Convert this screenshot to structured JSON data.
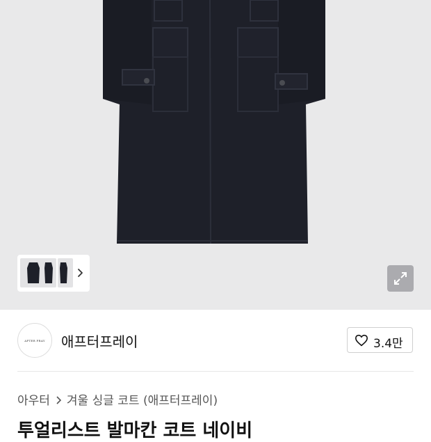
{
  "product": {
    "thumbnails": [
      {
        "name": "coat-front"
      },
      {
        "name": "coat-side"
      },
      {
        "name": "coat-back"
      }
    ],
    "icons": {
      "thumbs_next": "chevron-right-icon",
      "expand": "expand-icon",
      "like": "heart-icon",
      "breadcrumb_sep": "chevron-right-icon"
    },
    "brand": {
      "logo_text": "AFTER PRAY",
      "name": "애프터프레이"
    },
    "likes": {
      "count": "3.4만"
    },
    "breadcrumb": {
      "category": "아우터",
      "subcategory": "겨울 싱글 코트 (애프터프레이)"
    },
    "title": "투얼리스트 발마칸 코트 네이비"
  },
  "colors": {
    "coat": "#1e2029",
    "hero_bg": "#e9e9ea",
    "text_primary": "#111111",
    "text_secondary": "#555555"
  }
}
